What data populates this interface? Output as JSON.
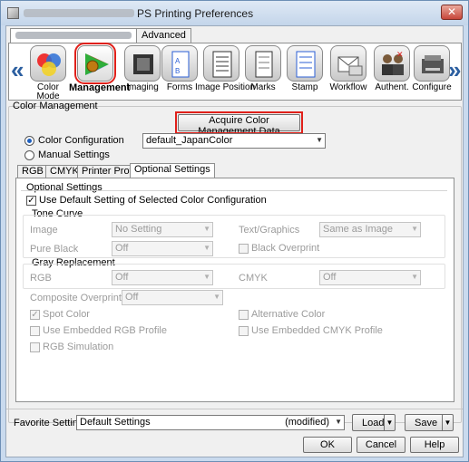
{
  "window": {
    "title": "PS Printing Preferences",
    "close_glyph": "✕"
  },
  "top_tabs": {
    "blurred_tab": "",
    "advanced": "Advanced"
  },
  "toolbar": {
    "left_arrow": "«",
    "right_arrow": "»",
    "items": [
      {
        "label": "Color\nMode",
        "icon": "color-mode-icon"
      },
      {
        "label": "Management",
        "icon": "color-management-icon",
        "selected": true
      },
      {
        "label": "Imaging",
        "icon": "imaging-icon"
      },
      {
        "label": "Forms",
        "icon": "forms-icon"
      },
      {
        "label": "Image Position",
        "icon": "image-position-icon"
      },
      {
        "label": "Marks",
        "icon": "marks-icon"
      },
      {
        "label": "Stamp",
        "icon": "stamp-icon"
      },
      {
        "label": "Workflow",
        "icon": "workflow-icon"
      },
      {
        "label": "Authent.",
        "icon": "authentication-icon"
      },
      {
        "label": "Configure",
        "icon": "configure-icon"
      }
    ]
  },
  "color_management": {
    "group_title": "Color Management",
    "acquire_button": "Acquire Color Management Data",
    "color_configuration_label": "Color Configuration",
    "color_configuration_value": "default_JapanColor",
    "manual_settings_label": "Manual Settings",
    "tabs": [
      "RGB",
      "CMYK",
      "Printer Profile",
      "Optional Settings"
    ],
    "active_tab": "Optional Settings"
  },
  "optional_settings": {
    "group_title": "Optional Settings",
    "use_default_label": "Use Default Setting of Selected Color Configuration",
    "use_default_checked": "✓",
    "tone_curve_title": "Tone Curve",
    "image_label": "Image",
    "image_value": "No Setting",
    "text_graphics_label": "Text/Graphics",
    "text_graphics_value": "Same as Image",
    "pure_black_label": "Pure Black",
    "pure_black_value": "Off",
    "black_overprint_label": "Black Overprint",
    "gray_replacement_title": "Gray Replacement",
    "rgb_label": "RGB",
    "rgb_value": "Off",
    "cmyk_label": "CMYK",
    "cmyk_value": "Off",
    "composite_overprint_label": "Composite Overprint",
    "composite_overprint_value": "Off",
    "spot_color_label": "Spot Color",
    "spot_color_checked": "✓",
    "alternative_color_label": "Alternative Color",
    "use_embedded_rgb_label": "Use Embedded RGB Profile",
    "use_embedded_cmyk_label": "Use Embedded CMYK Profile",
    "rgb_simulation_label": "RGB Simulation"
  },
  "footer": {
    "favorite_setting_label": "Favorite Setting",
    "favorite_setting_value": "Default Settings",
    "modified_text": "(modified)",
    "load_button": "Load",
    "save_button": "Save",
    "ok_button": "OK",
    "cancel_button": "Cancel",
    "help_button": "Help"
  },
  "colors": {
    "accent_red": "#e0201a",
    "title_bar": "#c3d5ea",
    "radio_blue": "#1d5fbf"
  }
}
